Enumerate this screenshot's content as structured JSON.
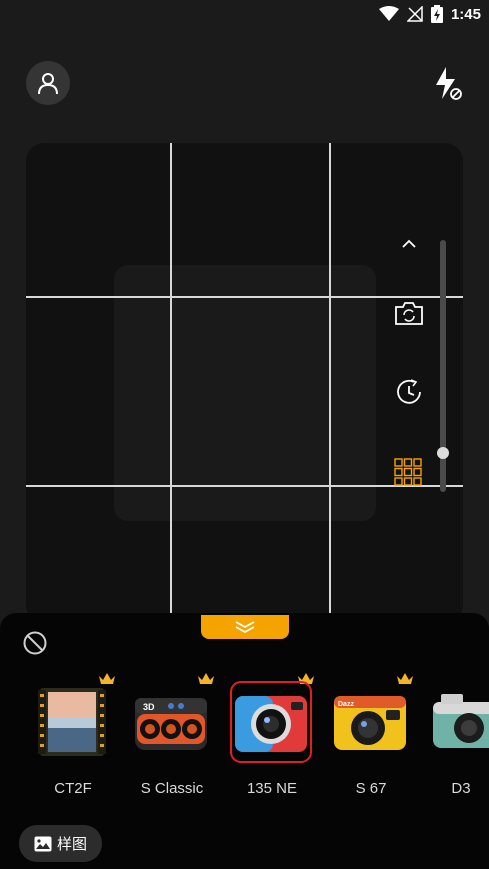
{
  "status_bar": {
    "time": "1:45",
    "icons": [
      "wifi-icon",
      "no-signal-icon",
      "battery-charging-icon"
    ]
  },
  "header": {
    "account_icon": "person-icon",
    "flash_icon": "flash-off-icon"
  },
  "viewfinder": {
    "grid": "3x3",
    "controls": [
      "chevron-up-icon",
      "switch-camera-icon",
      "timer-icon",
      "grid-icon"
    ],
    "zoom_level": 0.16
  },
  "filter_panel": {
    "collapse_icon": "double-chevron-down-icon",
    "no_filter_icon": "prohibit-icon",
    "cameras": [
      {
        "label": "CT2F",
        "premium": true,
        "selected": false
      },
      {
        "label": "S Classic",
        "premium": true,
        "selected": false
      },
      {
        "label": "135 NE",
        "premium": true,
        "selected": true
      },
      {
        "label": "S 67",
        "premium": true,
        "selected": false
      },
      {
        "label": "D3",
        "premium": false,
        "selected": false
      }
    ],
    "sample_button": {
      "label": "样图",
      "icon": "image-icon"
    }
  },
  "colors": {
    "accent": "#f5a300",
    "selection": "#e02020",
    "background": "#1b1b1b",
    "panel": "#050505"
  }
}
